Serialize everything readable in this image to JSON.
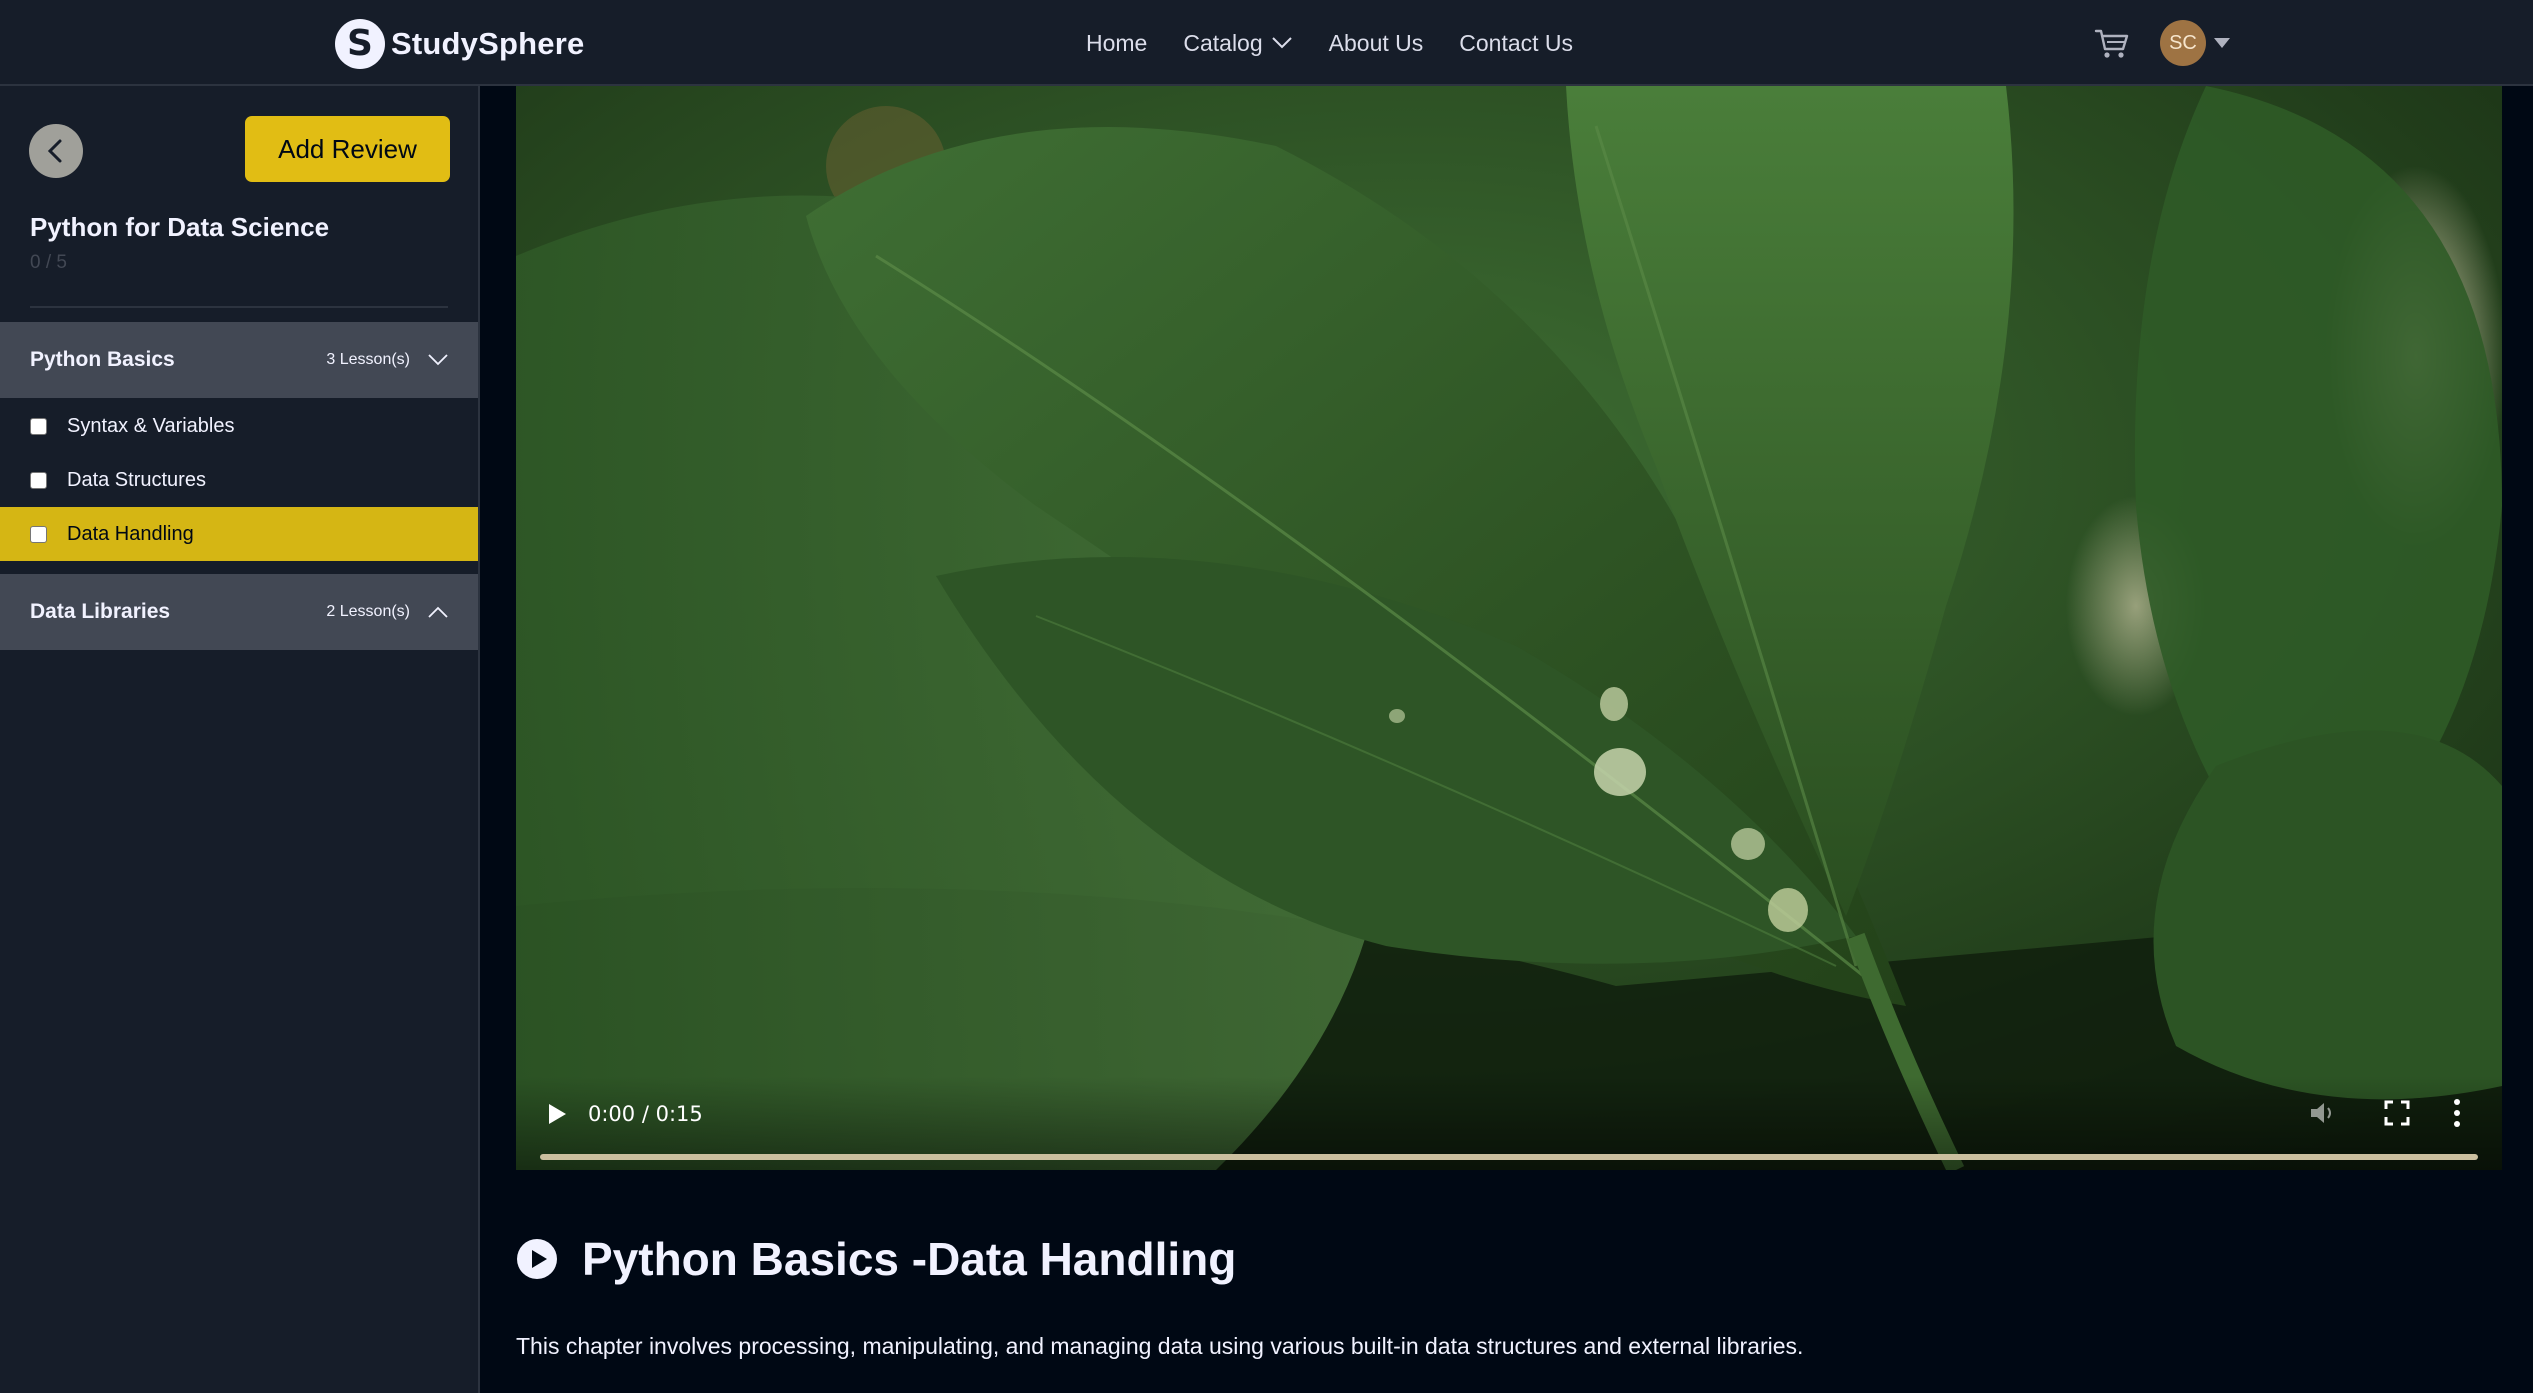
{
  "brand": {
    "name": "StudySphere",
    "mark": "S"
  },
  "nav": {
    "links": [
      {
        "label": "Home"
      },
      {
        "label": "Catalog"
      },
      {
        "label": "About Us"
      },
      {
        "label": "Contact Us"
      }
    ],
    "avatar_initials": "SC"
  },
  "sidebar": {
    "add_review_label": "Add Review",
    "course_title": "Python for Data Science",
    "progress_text": "0 / 5",
    "sections": [
      {
        "title": "Python Basics",
        "count": "3 Lesson(s)",
        "expanded": true,
        "lessons": [
          {
            "label": "Syntax & Variables",
            "checked": false,
            "active": false
          },
          {
            "label": "Data Structures",
            "checked": false,
            "active": false
          },
          {
            "label": "Data Handling",
            "checked": false,
            "active": true
          }
        ]
      },
      {
        "title": "Data Libraries",
        "count": "2 Lesson(s)",
        "expanded": false,
        "lessons": []
      }
    ]
  },
  "player": {
    "time": "0:00 / 0:15",
    "progress": 0,
    "volume_muted": true
  },
  "lesson": {
    "title": "Python Basics -Data Handling",
    "description": "This chapter involves processing, manipulating, and managing data using various built-in data structures and external libraries."
  },
  "colors": {
    "navbar_bg": "#161d29",
    "page_bg": "#000814",
    "accent_yellow": "#e1bd14",
    "section_bg": "#424854"
  }
}
